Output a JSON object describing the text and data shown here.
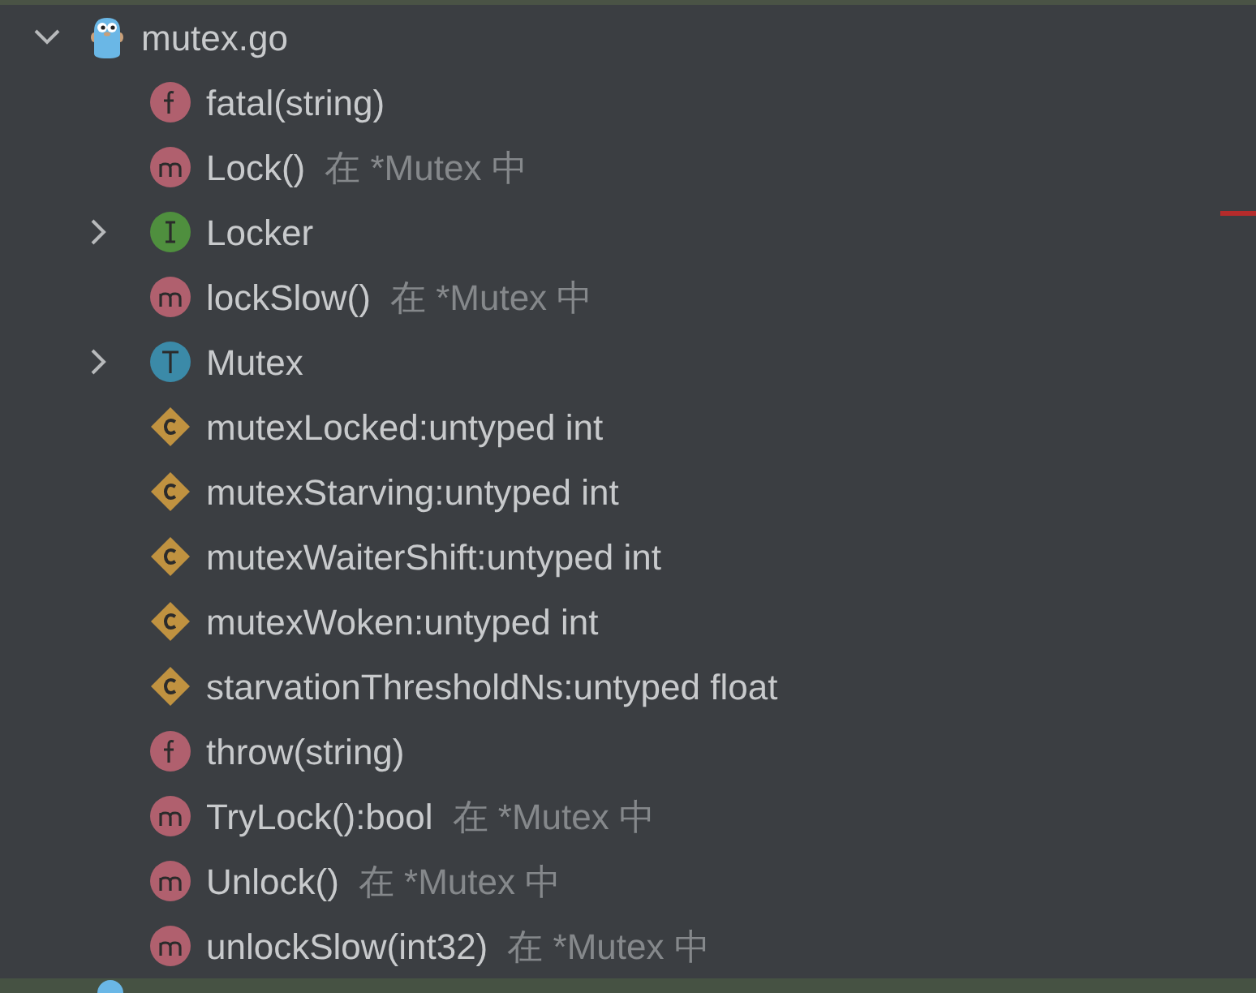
{
  "root": {
    "label": "mutex.go",
    "expanded": true
  },
  "items": [
    {
      "kind": "function",
      "label": "fatal(string)"
    },
    {
      "kind": "method",
      "label": "Lock()",
      "location": "在 *Mutex 中"
    },
    {
      "kind": "interface",
      "label": "Locker",
      "expanded": false
    },
    {
      "kind": "method",
      "label": "lockSlow()",
      "location": "在 *Mutex 中"
    },
    {
      "kind": "type",
      "label": "Mutex",
      "expanded": false
    },
    {
      "kind": "constant",
      "label": "mutexLocked:untyped int"
    },
    {
      "kind": "constant",
      "label": "mutexStarving:untyped int"
    },
    {
      "kind": "constant",
      "label": "mutexWaiterShift:untyped int"
    },
    {
      "kind": "constant",
      "label": "mutexWoken:untyped int"
    },
    {
      "kind": "constant",
      "label": "starvationThresholdNs:untyped float"
    },
    {
      "kind": "function",
      "label": "throw(string)"
    },
    {
      "kind": "method",
      "label": "TryLock():bool",
      "location": "在 *Mutex 中"
    },
    {
      "kind": "method",
      "label": "Unlock()",
      "location": "在 *Mutex 中"
    },
    {
      "kind": "method",
      "label": "unlockSlow(int32)",
      "location": "在 *Mutex 中"
    }
  ]
}
